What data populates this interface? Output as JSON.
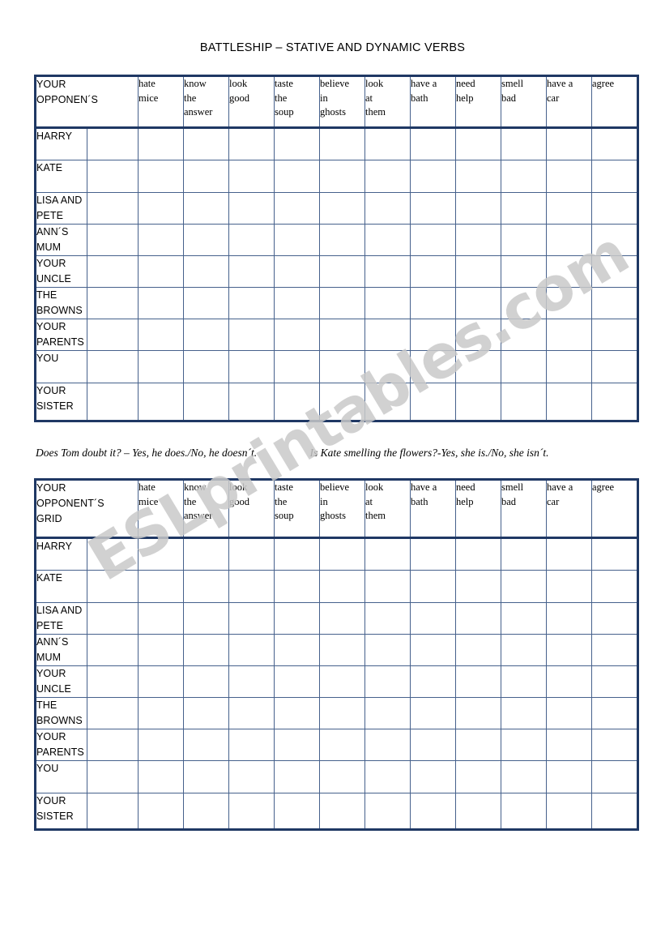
{
  "page": {
    "title": "BATTLESHIP – STATIVE AND DYNAMIC VERBS",
    "watermark": "ESLprintables.com",
    "accent_color": "#1f3864",
    "grid_line_color": "#46618c",
    "gap_column_color": "#f2f2f2"
  },
  "verbs": [
    "hate\nmice",
    "know\nthe\nanswer",
    "look\ngood",
    "taste\nthe\nsoup",
    "believe\nin\nghosts",
    "look\nat\nthem",
    "have a\nbath",
    "need\nhelp",
    "smell\nbad",
    "have a\ncar",
    "agree"
  ],
  "subjects": [
    "HARRY",
    "KATE",
    "LISA AND\nPETE",
    "ANN´S\nMUM",
    "YOUR\nUNCLE",
    "THE\nBROWNS",
    "YOUR\nPARENTS",
    "YOU",
    "YOUR\nSISTER"
  ],
  "grids": [
    {
      "corner_label": "YOUR\nOPPONEN´S"
    },
    {
      "corner_label": "YOUR\nOPPONENT´S\nGRID"
    }
  ],
  "examples": {
    "first": "Does Tom doubt it? – Yes, he does./No, he doesn´t.",
    "second": "Is Kate smelling the flowers?-Yes, she is./No, she isn´t."
  }
}
